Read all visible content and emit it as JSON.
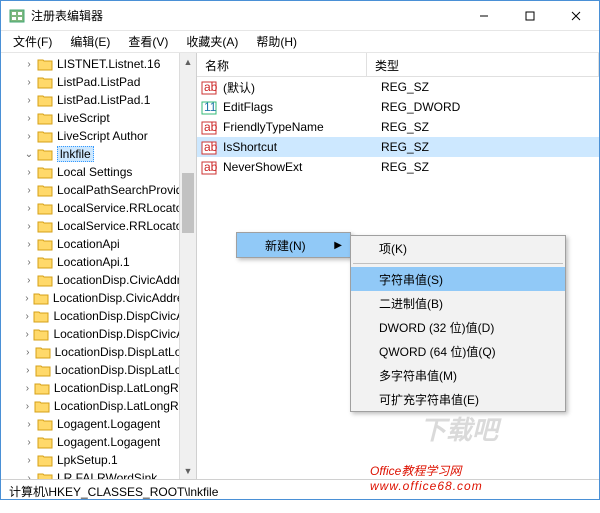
{
  "window": {
    "title": "注册表编辑器"
  },
  "menu": {
    "file": "文件(F)",
    "edit": "编辑(E)",
    "view": "查看(V)",
    "favorites": "收藏夹(A)",
    "help": "帮助(H)"
  },
  "tree": {
    "items": [
      {
        "label": "LISTNET.Listnet.16",
        "selected": false
      },
      {
        "label": "ListPad.ListPad",
        "selected": false
      },
      {
        "label": "ListPad.ListPad.1",
        "selected": false
      },
      {
        "label": "LiveScript",
        "selected": false
      },
      {
        "label": "LiveScript Author",
        "selected": false
      },
      {
        "label": "lnkfile",
        "selected": true
      },
      {
        "label": "Local Settings",
        "selected": false
      },
      {
        "label": "LocalPathSearchProvider",
        "selected": false
      },
      {
        "label": "LocalService.RRLocator",
        "selected": false
      },
      {
        "label": "LocalService.RRLocator",
        "selected": false
      },
      {
        "label": "LocationApi",
        "selected": false
      },
      {
        "label": "LocationApi.1",
        "selected": false
      },
      {
        "label": "LocationDisp.CivicAddress",
        "selected": false
      },
      {
        "label": "LocationDisp.CivicAddressReportFactory",
        "selected": false
      },
      {
        "label": "LocationDisp.DispCivicAddressReport",
        "selected": false
      },
      {
        "label": "LocationDisp.DispCivicAddressReport",
        "selected": false
      },
      {
        "label": "LocationDisp.DispLatLongReport",
        "selected": false
      },
      {
        "label": "LocationDisp.DispLatLongReport",
        "selected": false
      },
      {
        "label": "LocationDisp.LatLongReportFactory",
        "selected": false
      },
      {
        "label": "LocationDisp.LatLongReportFactory",
        "selected": false
      },
      {
        "label": "Logagent.Logagent",
        "selected": false
      },
      {
        "label": "Logagent.Logagent",
        "selected": false
      },
      {
        "label": "LpkSetup.1",
        "selected": false
      },
      {
        "label": "LR.FALRWordSink",
        "selected": false
      }
    ]
  },
  "list": {
    "columns": {
      "name": "名称",
      "type": "类型"
    },
    "rows": [
      {
        "icon": "string",
        "name": "(默认)",
        "type": "REG_SZ",
        "selected": false
      },
      {
        "icon": "binary",
        "name": "EditFlags",
        "type": "REG_DWORD",
        "selected": false
      },
      {
        "icon": "string",
        "name": "FriendlyTypeName",
        "type": "REG_SZ",
        "selected": false
      },
      {
        "icon": "string",
        "name": "IsShortcut",
        "type": "REG_SZ",
        "selected": true
      },
      {
        "icon": "string",
        "name": "NeverShowExt",
        "type": "REG_SZ",
        "selected": false
      }
    ]
  },
  "context_menu": {
    "new_label": "新建(N)",
    "sub": {
      "key": "项(K)",
      "string": "字符串值(S)",
      "binary": "二进制值(B)",
      "dword": "DWORD (32 位)值(D)",
      "qword": "QWORD (64 位)值(Q)",
      "multi": "多字符串值(M)",
      "expand": "可扩充字符串值(E)"
    }
  },
  "statusbar": {
    "path": "计算机\\HKEY_CLASSES_ROOT\\lnkfile"
  },
  "watermark": {
    "line1": "Office教程学习网",
    "line2": "www.office68.com"
  },
  "dl_watermark": "下载吧"
}
